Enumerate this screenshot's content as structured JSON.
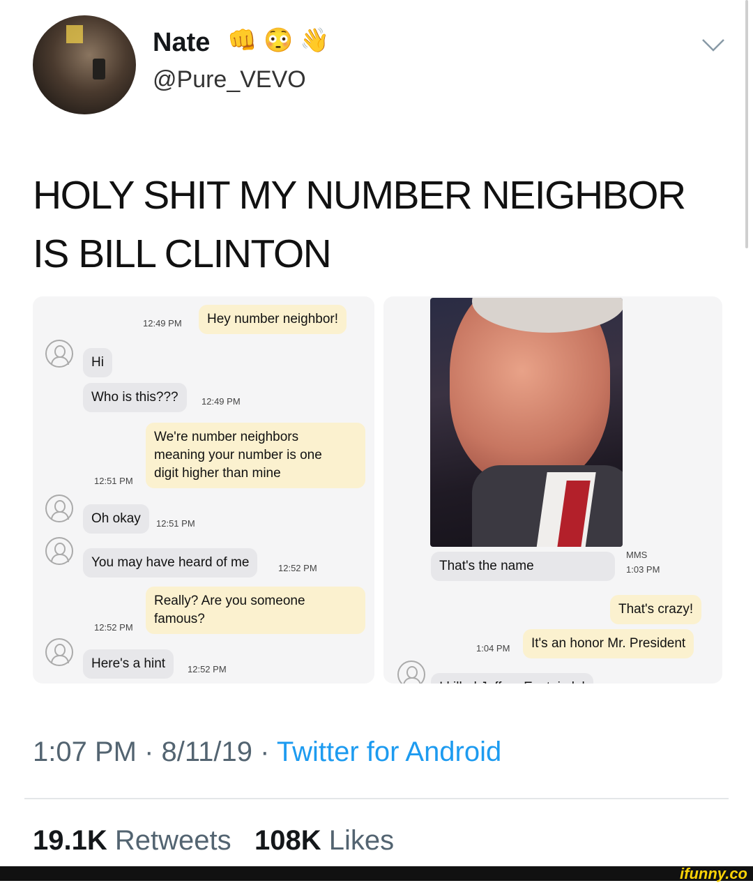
{
  "tweet": {
    "display_name": "Nate",
    "emojis": [
      "👊",
      "😳",
      "👋"
    ],
    "handle": "@Pure_VEVO",
    "text": "HOLY SHIT MY NUMBER NEIGHBOR IS BILL CLINTON",
    "time": "1:07 PM",
    "sep1": "·",
    "date": "8/11/19",
    "sep2": "·",
    "source": "Twitter for Android",
    "retweets_count": "19.1K",
    "retweets_label": "Retweets",
    "likes_count": "108K",
    "likes_label": "Likes",
    "accent_color": "#1d9bf0"
  },
  "conversation_left": [
    {
      "text": "Hey number neighbor!",
      "time": "12:49 PM"
    },
    {
      "text": "Hi",
      "time": ""
    },
    {
      "text": "Who is this???",
      "time": "12:49 PM"
    },
    {
      "text": "We're number neighbors\nmeaning your number is one\ndigit higher than mine",
      "time": "12:51 PM"
    },
    {
      "text": "Oh okay",
      "time": "12:51 PM"
    },
    {
      "text": "You may have heard of me",
      "time": "12:52 PM"
    },
    {
      "text": "Really? Are you someone\nfamous?",
      "time": "12:52 PM"
    },
    {
      "text": "Here's a hint",
      "time": "12:52 PM"
    }
  ],
  "conversation_right": [
    {
      "text": "That's the name",
      "tag": "MMS",
      "time": "1:03 PM"
    },
    {
      "text": "That's crazy!",
      "time": ""
    },
    {
      "text": "It's an honor Mr. President",
      "time": "1:04 PM"
    },
    {
      "text": "I killed Jeffrey Epstein lol",
      "time": ""
    }
  ],
  "watermark": "ifunny.co"
}
